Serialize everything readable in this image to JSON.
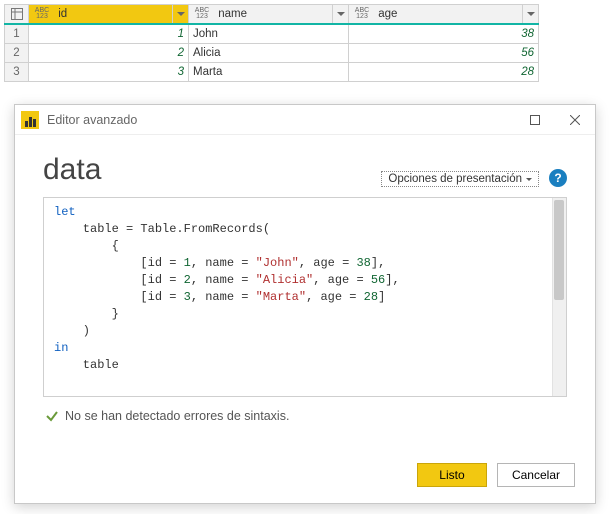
{
  "columns": [
    {
      "name": "id",
      "type_top": "ABC",
      "type_bot": "123"
    },
    {
      "name": "name",
      "type_top": "ABC",
      "type_bot": "123"
    },
    {
      "name": "age",
      "type_top": "ABC",
      "type_bot": "123"
    }
  ],
  "rows": [
    {
      "n": "1",
      "id": "1",
      "name": "John",
      "age": "38"
    },
    {
      "n": "2",
      "id": "2",
      "name": "Alicia",
      "age": "56"
    },
    {
      "n": "3",
      "id": "3",
      "name": "Marta",
      "age": "28"
    }
  ],
  "dialog": {
    "title": "Editor avanzado",
    "query_name": "data",
    "display_options_label": "Opciones de presentación",
    "code": {
      "records": [
        {
          "id": "1",
          "name": "\"John\"",
          "age": "38"
        },
        {
          "id": "2",
          "name": "\"Alicia\"",
          "age": "56"
        },
        {
          "id": "3",
          "name": "\"Marta\"",
          "age": "28"
        }
      ],
      "kw_let": "let",
      "kw_in": "in",
      "var": "table",
      "fn": "Table.FromRecords"
    },
    "status": "No se han detectado errores de sintaxis.",
    "done_label": "Listo",
    "cancel_label": "Cancelar"
  }
}
